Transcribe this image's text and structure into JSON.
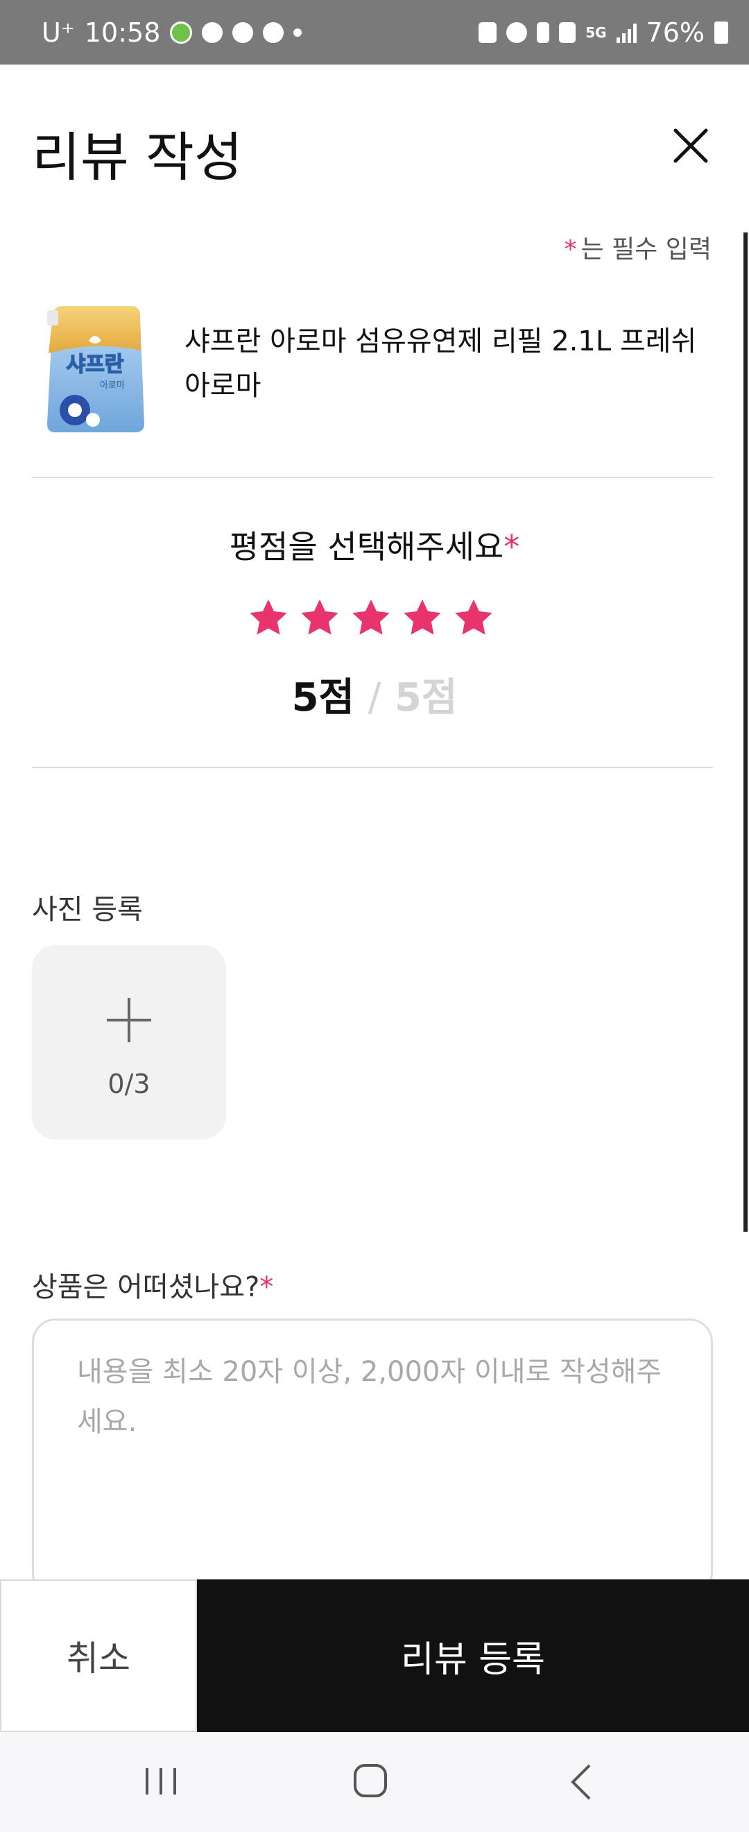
{
  "status_bar": {
    "carrier": "U⁺",
    "time": "10:58",
    "network": "5G",
    "battery": "76%"
  },
  "header": {
    "title": "리뷰 작성"
  },
  "required_note": {
    "marker": "*",
    "text": "는 필수 입력"
  },
  "product": {
    "name": "샤프란 아로마 섬유유연제 리필 2.1L 프레쉬 아로마",
    "image_brand_text": "샤프란",
    "image_sub_text": "아로마"
  },
  "rating": {
    "prompt": "평점을 선택해주세요",
    "required_marker": "*",
    "stars_selected": 5,
    "stars_total": 5,
    "score_current": "5점",
    "score_separator": "/",
    "score_max": "5점",
    "star_color": "#e8336d"
  },
  "photo": {
    "label": "사진 등록",
    "count": "0/3"
  },
  "review": {
    "label": "상품은 어떠셨나요?",
    "required_marker": "*",
    "value": "",
    "placeholder": "내용을 최소 20자 이상, 2,000자 이내로 작성해주세요."
  },
  "actions": {
    "cancel_label": "취소",
    "submit_label": "리뷰 등록"
  },
  "colors": {
    "accent": "#e8336d",
    "primary_button": "#111111"
  }
}
